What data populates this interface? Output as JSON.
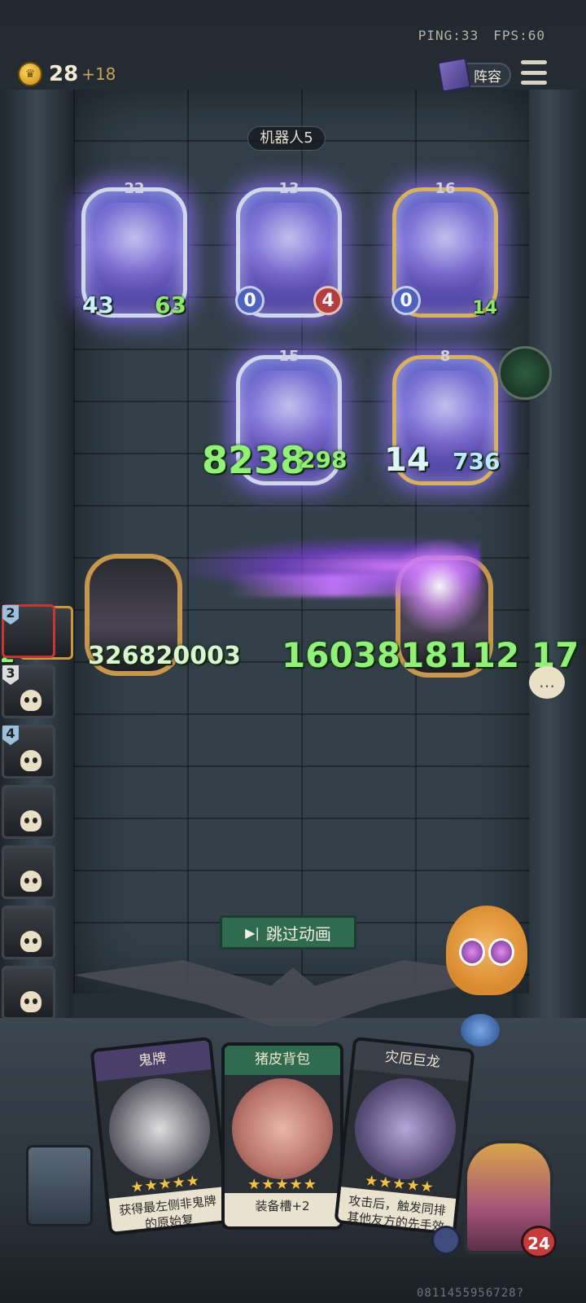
{
  "hud": {
    "ping": "PING:33",
    "fps": "FPS:60",
    "gold": "28",
    "gold_income": "+18",
    "lineup_label": "阵容"
  },
  "opponent": {
    "name": "机器人5"
  },
  "enemy_board": [
    {
      "level": "22",
      "attack": "43",
      "health": "63"
    },
    {
      "level": "13",
      "attack": "0",
      "health": "4"
    },
    {
      "level": "16",
      "attack": "0",
      "health": "14"
    },
    {
      "level": "15",
      "attack": "8238",
      "health": "298"
    },
    {
      "level": "8",
      "attack": "14",
      "health": "736"
    }
  ],
  "combat": {
    "left_number": "326820003",
    "left_prefix": "2",
    "right_number": "1603818112 17"
  },
  "roster": [
    "1",
    "2",
    "3",
    "4",
    "",
    "",
    "",
    ""
  ],
  "skip_button": "跳过动画",
  "shop": [
    {
      "title": "鬼牌",
      "stars": "★★★★★",
      "desc": "获得最左侧非鬼牌的原始复"
    },
    {
      "title": "猪皮背包",
      "stars": "★★★★★",
      "desc": "装备槽+2"
    },
    {
      "title": "灾厄巨龙",
      "stars": "★★★★★",
      "desc": "攻击后，触发同排其他友方的先手效"
    }
  ],
  "player": {
    "health": "24"
  },
  "uid": "0811455956728?"
}
